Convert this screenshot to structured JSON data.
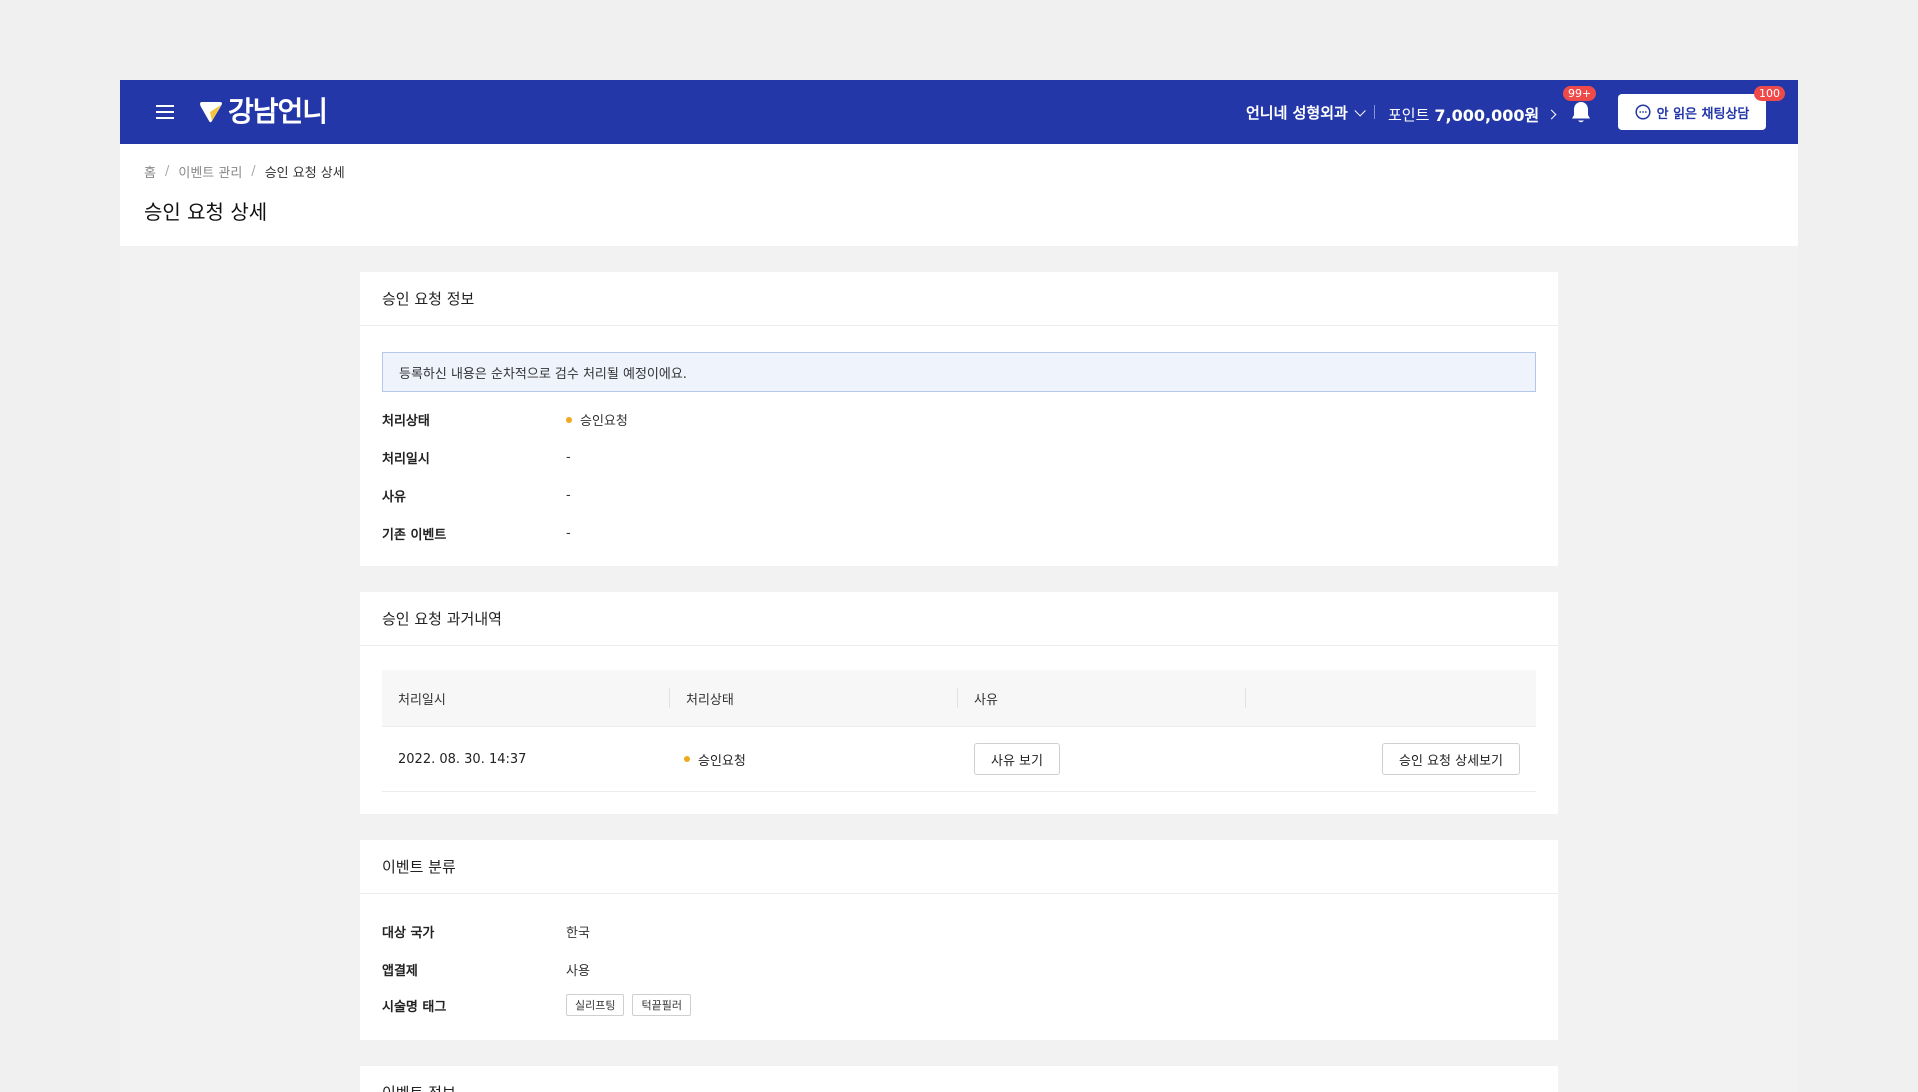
{
  "header": {
    "logo_text": "강남언니",
    "hospital_name": "언니네 성형외과",
    "points_label": "포인트",
    "points_value": "7,000,000원",
    "notification_badge": "99+",
    "chat_button_label": "안 읽은 채팅상담",
    "chat_badge": "100",
    "colors": {
      "brand": "#2437a8",
      "badge": "#ef4a4a",
      "status_dot": "#f0a81c"
    }
  },
  "breadcrumb": {
    "home": "홈",
    "parent": "이벤트 관리",
    "current": "승인 요청 상세"
  },
  "page_title": "승인 요청 상세",
  "approval_info": {
    "title": "승인 요청 정보",
    "notice": "등록하신 내용은 순차적으로 검수 처리될 예정이에요.",
    "rows": [
      {
        "label": "처리상태",
        "value": "승인요청"
      },
      {
        "label": "처리일시",
        "value": "-"
      },
      {
        "label": "사유",
        "value": "-"
      },
      {
        "label": "기존 이벤트",
        "value": "-"
      }
    ]
  },
  "history": {
    "title": "승인 요청 과거내역",
    "columns": [
      "처리일시",
      "처리상태",
      "사유",
      ""
    ],
    "rows": [
      {
        "datetime": "2022. 08. 30. 14:37",
        "status": "승인요청",
        "reason_button": "사유 보기",
        "detail_button": "승인 요청 상세보기"
      }
    ]
  },
  "event_category": {
    "title": "이벤트 분류",
    "rows": [
      {
        "label": "대상 국가",
        "value": "한국"
      },
      {
        "label": "앱결제",
        "value": "사용"
      },
      {
        "label": "시술명 태그",
        "tags": [
          "실리프팅",
          "턱끝필러"
        ]
      }
    ]
  },
  "event_info": {
    "title": "이벤트 정보"
  }
}
